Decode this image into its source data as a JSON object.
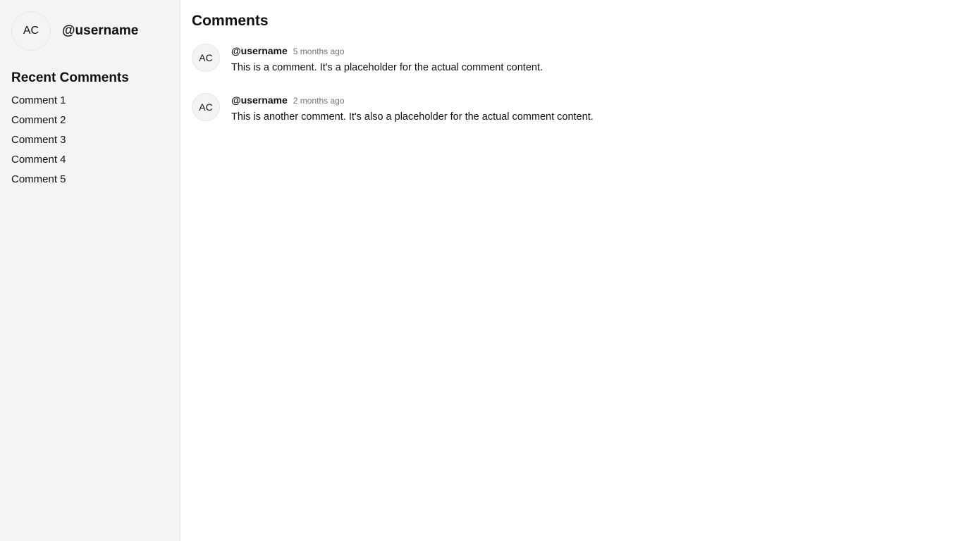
{
  "sidebar": {
    "profile": {
      "initials": "AC",
      "username": "@username"
    },
    "recent_title": "Recent Comments",
    "recent_items": [
      "Comment 1",
      "Comment 2",
      "Comment 3",
      "Comment 4",
      "Comment 5"
    ]
  },
  "main": {
    "title": "Comments",
    "comments": [
      {
        "initials": "AC",
        "username": "@username",
        "time": "5 months ago",
        "text": "This is a comment. It's a placeholder for the actual comment content."
      },
      {
        "initials": "AC",
        "username": "@username",
        "time": "2 months ago",
        "text": "This is another comment. It's also a placeholder for the actual comment content."
      }
    ]
  }
}
